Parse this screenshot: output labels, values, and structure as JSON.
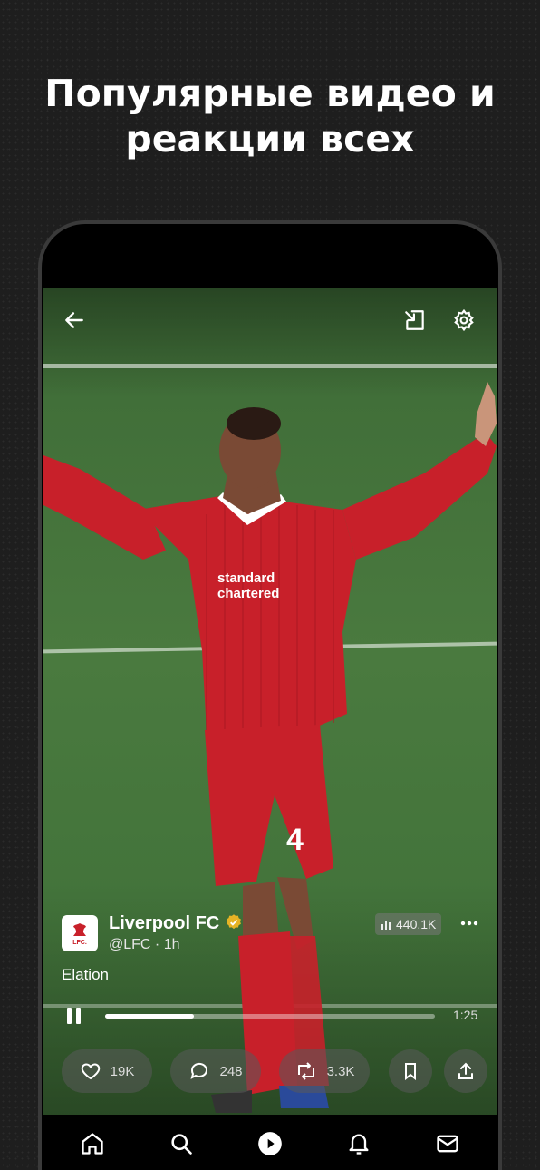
{
  "headline": {
    "line1": "Популярные видео и",
    "line2": "реакции всех"
  },
  "video": {
    "author_name": "Liverpool FC",
    "author_handle": "@LFC · 1h",
    "verified": true,
    "views": "440.1K",
    "caption": "Elation",
    "duration": "1:25",
    "progress_fraction": 0.27,
    "avatar_text": "LFC."
  },
  "actions": {
    "likes": "19K",
    "replies": "248",
    "reposts": "3.3K"
  },
  "colors": {
    "accent": "#ffffff",
    "verified_badge": "#e6b325",
    "kit_red": "#c8202a",
    "background": "#1e1e1e"
  },
  "icons": {
    "back": "arrow-left-icon",
    "pip": "picture-in-picture-icon",
    "settings": "gear-icon",
    "views": "bar-chart-icon",
    "more": "more-dots-icon",
    "like": "heart-icon",
    "reply": "speech-bubble-icon",
    "repost": "repost-icon",
    "bookmark": "bookmark-icon",
    "share": "share-icon",
    "nav": [
      "home-icon",
      "search-icon",
      "play-icon",
      "bell-icon",
      "mail-icon"
    ]
  }
}
